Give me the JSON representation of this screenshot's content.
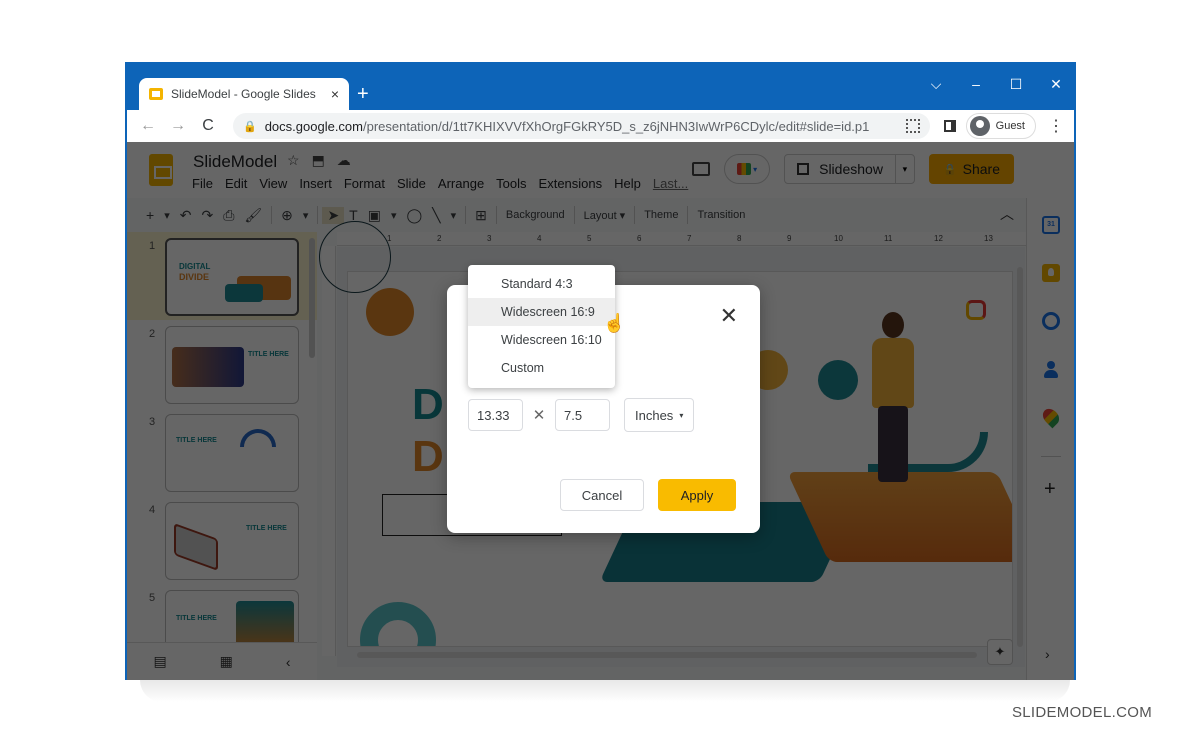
{
  "browser": {
    "tab_title": "SlideModel - Google Slides",
    "tab_close_icon": "×",
    "new_tab_icon": "+",
    "window_controls": {
      "dropdown": "⌵",
      "minimize": "–",
      "maximize": "☐",
      "close": "✕"
    },
    "nav": {
      "back": "←",
      "forward": "→",
      "reload": "C"
    },
    "url_host": "docs.google.com",
    "url_path": "/presentation/d/1tt7KHIXVVfXhOrgFGkRY5D_s_z6jNHN3IwWrP6CDylc/edit#slide=id.p1",
    "lock_icon": "🔒",
    "profile_label": "Guest",
    "menu_icon": "⋮"
  },
  "app": {
    "doc_title": "SlideModel",
    "title_icons": {
      "star": "☆",
      "move": "⬒",
      "cloud": "☁"
    },
    "menu": [
      "File",
      "Edit",
      "View",
      "Insert",
      "Format",
      "Slide",
      "Arrange",
      "Tools",
      "Extensions",
      "Help"
    ],
    "last_edit": "Last...",
    "slideshow_label": "Slideshow",
    "slideshow_caret": "▾",
    "share_label": "Share",
    "share_lock": "🔒",
    "meet_caret": "▾"
  },
  "toolbar": {
    "icons": {
      "new": "+",
      "new_caret": "▾",
      "undo": "↶",
      "redo": "↷",
      "print": "⎙",
      "paint": "🖌",
      "zoom": "⊕",
      "zoom_caret": "▾",
      "select": "➤",
      "textbox": "T",
      "image": "▣",
      "image_caret": "▾",
      "shape": "◯",
      "line": "╲",
      "line_caret": "▾",
      "comment": "⊞"
    },
    "background_label": "Background",
    "layout_label": "Layout ▾",
    "theme_label": "Theme",
    "transition_label": "Transition",
    "collapse_icon": "︿"
  },
  "filmstrip": {
    "slides": [
      {
        "num": "1",
        "title": "DIGITAL",
        "title2": "DIVIDE"
      },
      {
        "num": "2",
        "title": "TITLE HERE"
      },
      {
        "num": "3",
        "title": "TITLE HERE"
      },
      {
        "num": "4",
        "title": "TITLE HERE"
      },
      {
        "num": "5",
        "title": "TITLE HERE"
      }
    ],
    "footer": {
      "list_view": "▤",
      "grid_view": "▦",
      "collapse": "‹"
    }
  },
  "ruler": {
    "ticks": [
      "1",
      "2",
      "3",
      "4",
      "5",
      "6",
      "7",
      "8",
      "9",
      "10",
      "11",
      "12",
      "13"
    ]
  },
  "slide": {
    "letter1": "D",
    "letter2": "D"
  },
  "canvas": {
    "explore_icon": "✦"
  },
  "side_panel": {
    "calendar_label": "31",
    "add_icon": "+",
    "expand_icon": "›"
  },
  "dialog": {
    "close_icon": "✕",
    "width_value": "13.33",
    "times_icon": "✕",
    "height_value": "7.5",
    "unit_label": "Inches",
    "unit_caret": "▾",
    "cancel_label": "Cancel",
    "apply_label": "Apply",
    "apply_color": "#f9bb00"
  },
  "dropdown": {
    "items": [
      {
        "label": "Standard 4:3"
      },
      {
        "label": "Widescreen 16:9",
        "hovered": true
      },
      {
        "label": "Widescreen 16:10"
      },
      {
        "label": "Custom"
      }
    ]
  },
  "cursor_icon": "☝",
  "footer_brand": "SLIDEMODEL.COM"
}
